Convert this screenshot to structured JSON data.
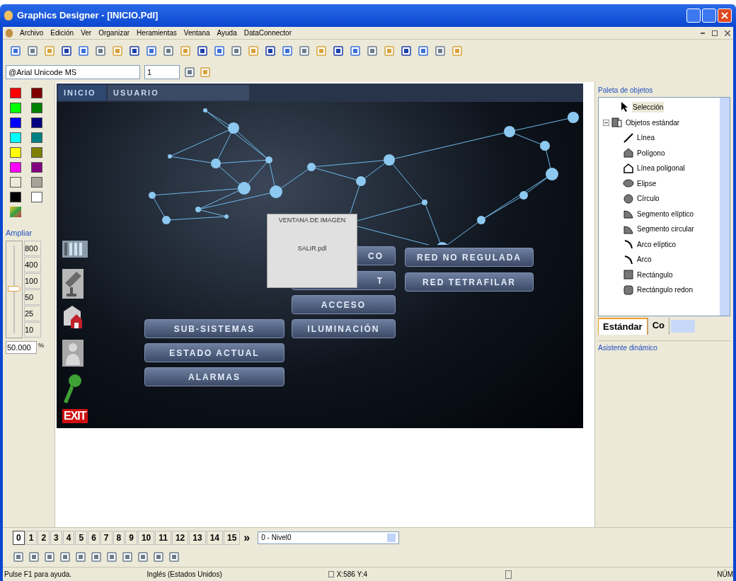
{
  "window": {
    "title": "Graphics Designer - [INICIO.Pdl]"
  },
  "menu": [
    "Archivo",
    "Edición",
    "Ver",
    "Organizar",
    "Heramientas",
    "Ventana",
    "Ayuda",
    "DataConnector"
  ],
  "font_toolbar": {
    "font": "@Arial Unicode MS",
    "size": "1"
  },
  "palette": [
    {
      "color": "#ff0000"
    },
    {
      "color": "#800000"
    },
    {
      "color": "#00ff00"
    },
    {
      "color": "#008000"
    },
    {
      "color": "#0000ff"
    },
    {
      "color": "#000080"
    },
    {
      "color": "#00ffff"
    },
    {
      "color": "#008080"
    },
    {
      "color": "#ffff00"
    },
    {
      "color": "#808000"
    },
    {
      "color": "#ff00ff"
    },
    {
      "color": "#800080"
    },
    {
      "color": "#ece9d8"
    },
    {
      "color": "#a8a498"
    },
    {
      "color": "#000000"
    },
    {
      "color": "#ffffff"
    }
  ],
  "zoom": {
    "label": "Ampliar",
    "ticks": [
      "800",
      "400",
      "100",
      "50",
      "25",
      "10"
    ],
    "level": 0.48,
    "value": "50.000",
    "unit": "%"
  },
  "screen": {
    "tabs": [
      {
        "label": "INICIO",
        "selected": true
      },
      {
        "label": "USUARIO",
        "selected": false
      }
    ],
    "side_icons": [
      {
        "kind": "rack"
      },
      {
        "kind": "camera"
      },
      {
        "kind": "house"
      },
      {
        "kind": "person"
      },
      {
        "kind": "key"
      },
      {
        "kind": "exit",
        "label": "EXIT"
      }
    ],
    "buttons": [
      {
        "label": "SUB-SISTEMAS"
      },
      {
        "label": "ESTADO ACTUAL"
      },
      {
        "label": "ALARMAS"
      },
      {
        "label": "CO"
      },
      {
        "label": "T"
      },
      {
        "label": "ACCESO"
      },
      {
        "label": "ILUMINACIÓN"
      },
      {
        "label": "RED NO REGULADA"
      },
      {
        "label": "RED TETRAFILAR"
      }
    ],
    "image_window": {
      "title": "VENTANA DE IMAGEN",
      "file": "SALIR.pdl"
    }
  },
  "object_palette": {
    "title": "Paleta de objetos",
    "tree": [
      {
        "label": "Selección",
        "selected": true
      },
      {
        "label": "Objetos estándar",
        "selected": false,
        "expanded": true,
        "children": [
          {
            "label": "Línea"
          },
          {
            "label": "Polígono"
          },
          {
            "label": "Línea poligonal"
          },
          {
            "label": "Elipse"
          },
          {
            "label": "Círculo"
          },
          {
            "label": "Segmento elíptico"
          },
          {
            "label": "Segmento circular"
          },
          {
            "label": "Arco elíptico"
          },
          {
            "label": "Arco"
          },
          {
            "label": "Rectángulo"
          },
          {
            "label": "Rectángulo redon"
          }
        ]
      }
    ],
    "tabs": [
      {
        "label": "Estándar",
        "selected": true
      },
      {
        "label": "Co",
        "selected": false
      }
    ]
  },
  "dynamic_wizard": {
    "title": "Asistente dinámico"
  },
  "layers": {
    "tabs": [
      {
        "label": "0",
        "selected": true
      },
      {
        "label": "1",
        "selected": false
      },
      {
        "label": "2",
        "selected": false
      },
      {
        "label": "3",
        "selected": false
      },
      {
        "label": "4",
        "selected": false
      },
      {
        "label": "5",
        "selected": false
      },
      {
        "label": "6",
        "selected": false
      },
      {
        "label": "7",
        "selected": false
      },
      {
        "label": "8",
        "selected": false
      },
      {
        "label": "9",
        "selected": false
      },
      {
        "label": "10",
        "selected": false
      },
      {
        "label": "11",
        "selected": false
      },
      {
        "label": "12",
        "selected": false
      },
      {
        "label": "13",
        "selected": false
      },
      {
        "label": "14",
        "selected": false
      },
      {
        "label": "15",
        "selected": false
      }
    ],
    "more": "»",
    "level_select": "0 - Nivel0"
  },
  "status_bar": {
    "help": "Pulse F1 para ayuda.",
    "language": "Inglés (Estados Unidos)",
    "position": "X:586 Y:4",
    "num": "NÚM"
  }
}
